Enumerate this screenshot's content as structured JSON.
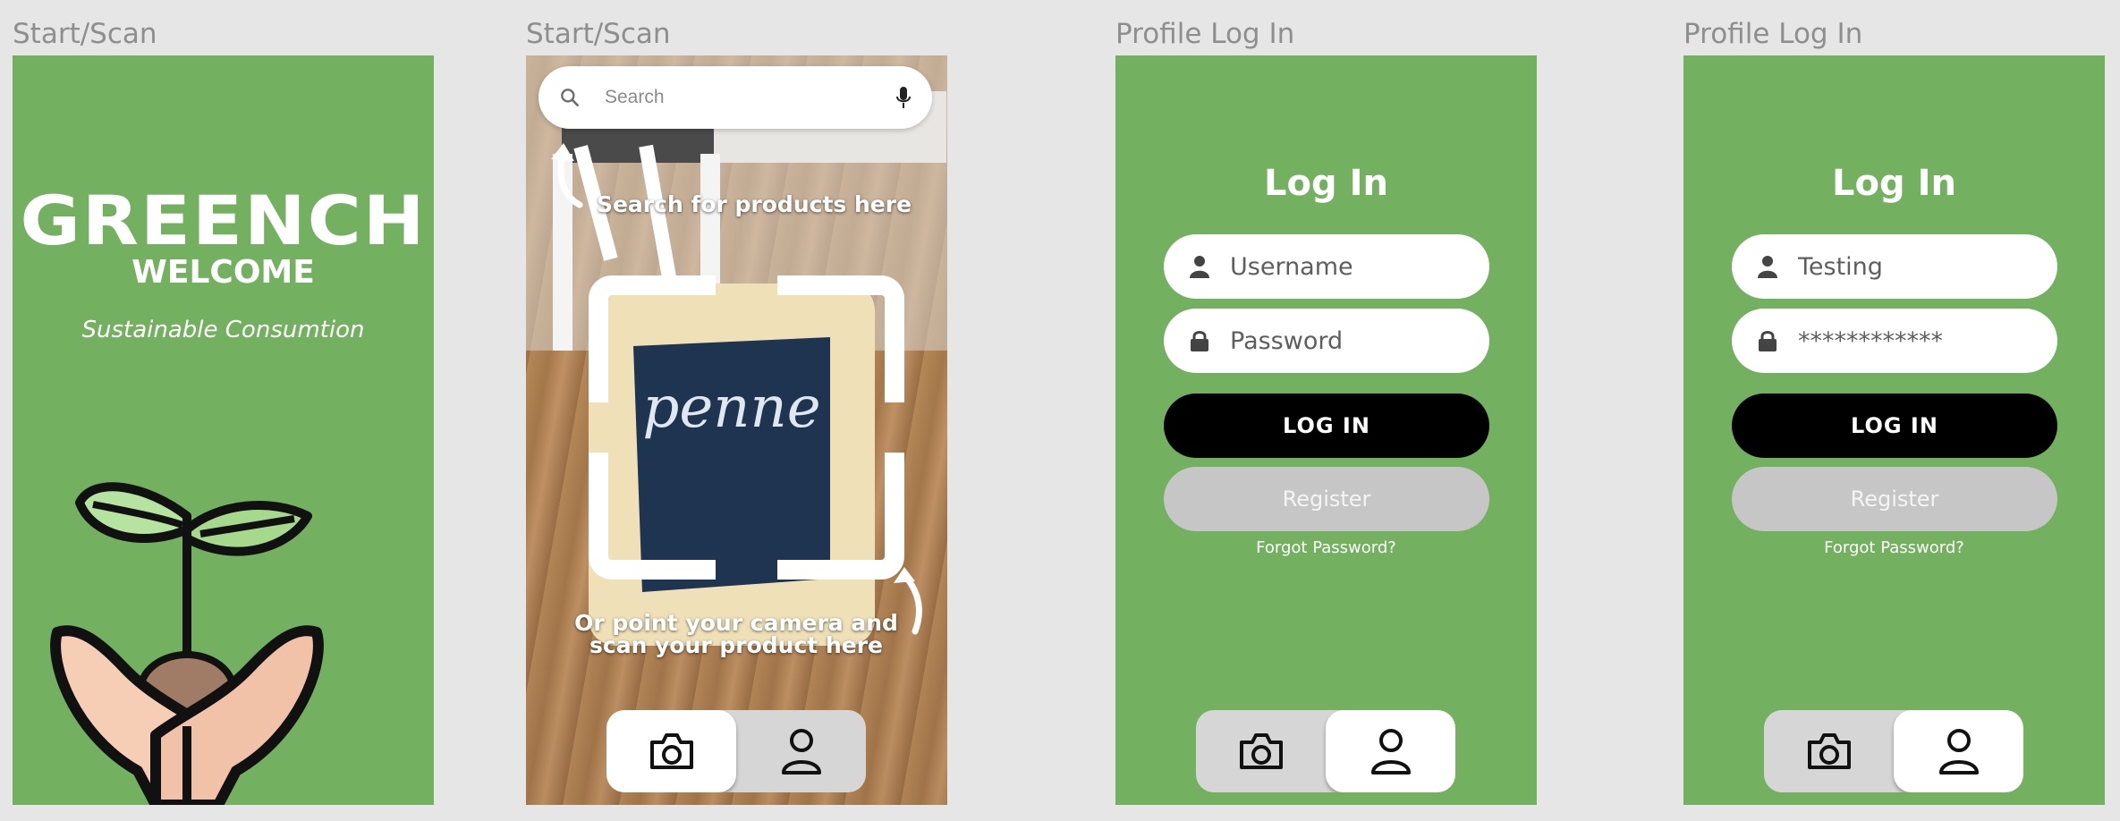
{
  "frames": [
    {
      "label": "Start/Scan"
    },
    {
      "label": "Start/Scan"
    },
    {
      "label": "Profile Log In"
    },
    {
      "label": "Profile Log In"
    }
  ],
  "splash": {
    "brand": "GREENCH",
    "welcome": "WELCOME",
    "tagline": "Sustainable Consumtion"
  },
  "scan": {
    "search_placeholder": "Search",
    "hint_search": "Search for products here",
    "hint_camera": "Or point your camera and scan your product here"
  },
  "login_empty": {
    "title": "Log In",
    "username": "Username",
    "password": "Password",
    "login_button": "LOG IN",
    "register_button": "Register",
    "forgot": "Forgot Password?"
  },
  "login_filled": {
    "title": "Log In",
    "username": "Testing",
    "password": "************",
    "login_button": "LOG IN",
    "register_button": "Register",
    "forgot": "Forgot Password?"
  },
  "colors": {
    "background": "#e6e6e6",
    "green": "#73b060",
    "login_button": "#000000",
    "register_button": "#c6c6c6"
  },
  "icons": [
    "search-icon",
    "microphone-icon",
    "camera-icon",
    "user-icon",
    "lock-icon",
    "arrow-icon",
    "plant-logo"
  ]
}
